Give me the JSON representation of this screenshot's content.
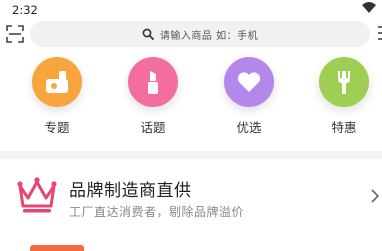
{
  "status_bar": {
    "time": "2:32"
  },
  "search": {
    "placeholder": "请输入商品 如：手机"
  },
  "categories": [
    {
      "label": "专题",
      "color": "#f7a53c",
      "icon": "gift-box-icon"
    },
    {
      "label": "话题",
      "color": "#f36ea0",
      "icon": "lipstick-icon"
    },
    {
      "label": "优选",
      "color": "#b488ea",
      "icon": "heart-icon"
    },
    {
      "label": "特惠",
      "color": "#9fce55",
      "icon": "fork-icon"
    }
  ],
  "brand_section": {
    "title": "品牌制造商直供",
    "subtitle": "工厂直达消费者，剔除品牌溢价",
    "accent_color": "#e8466e"
  },
  "colors": {
    "search_bg": "#f1f1f1",
    "divider": "#f4f4f4",
    "bottom_accent": "#f26a3d"
  }
}
